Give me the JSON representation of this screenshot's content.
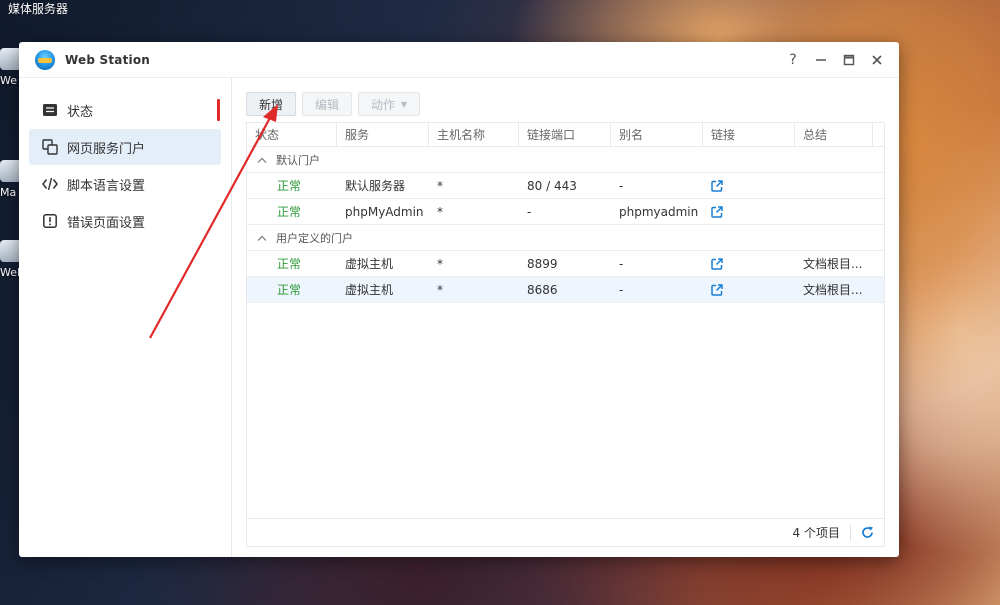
{
  "desktop": {
    "title": "媒体服务器",
    "icon_labels": [
      "We",
      "Ma",
      "WebD"
    ]
  },
  "window": {
    "title": "Web Station",
    "controls": {
      "help": "?",
      "minimize": "—",
      "maximize": "□",
      "close": "✕"
    }
  },
  "sidebar": {
    "items": [
      {
        "label": "状态",
        "icon": "status-list-icon",
        "active": false
      },
      {
        "label": "网页服务门户",
        "icon": "web-portal-icon",
        "active": true
      },
      {
        "label": "脚本语言设置",
        "icon": "code-icon",
        "active": false
      },
      {
        "label": "错误页面设置",
        "icon": "error-icon",
        "active": false
      }
    ]
  },
  "toolbar": {
    "create": "新增",
    "edit": "编辑",
    "action": "动作"
  },
  "table": {
    "columns": [
      "状态",
      "服务",
      "主机名称",
      "链接端口",
      "别名",
      "链接",
      "总结"
    ],
    "groups": [
      {
        "label": "默认门户",
        "rows": [
          {
            "status": "正常",
            "service": "默认服务器",
            "host": "*",
            "port": "80 / 443",
            "alias": "-",
            "summary": ""
          },
          {
            "status": "正常",
            "service": "phpMyAdmin",
            "host": "*",
            "port": "-",
            "alias": "phpmyadmin",
            "summary": ""
          }
        ]
      },
      {
        "label": "用户定义的门户",
        "rows": [
          {
            "status": "正常",
            "service": "虚拟主机",
            "host": "*",
            "port": "8899",
            "alias": "-",
            "summary": "文档根目..."
          },
          {
            "status": "正常",
            "service": "虚拟主机",
            "host": "*",
            "port": "8686",
            "alias": "-",
            "summary": "文档根目..."
          }
        ]
      }
    ],
    "footer": {
      "count": "4 个项目"
    }
  },
  "colors": {
    "status_ok": "#2e9b3a",
    "link_icon": "#1a7fd4",
    "annotation": "#e02a2a",
    "active_nav": "#e4eef8"
  }
}
